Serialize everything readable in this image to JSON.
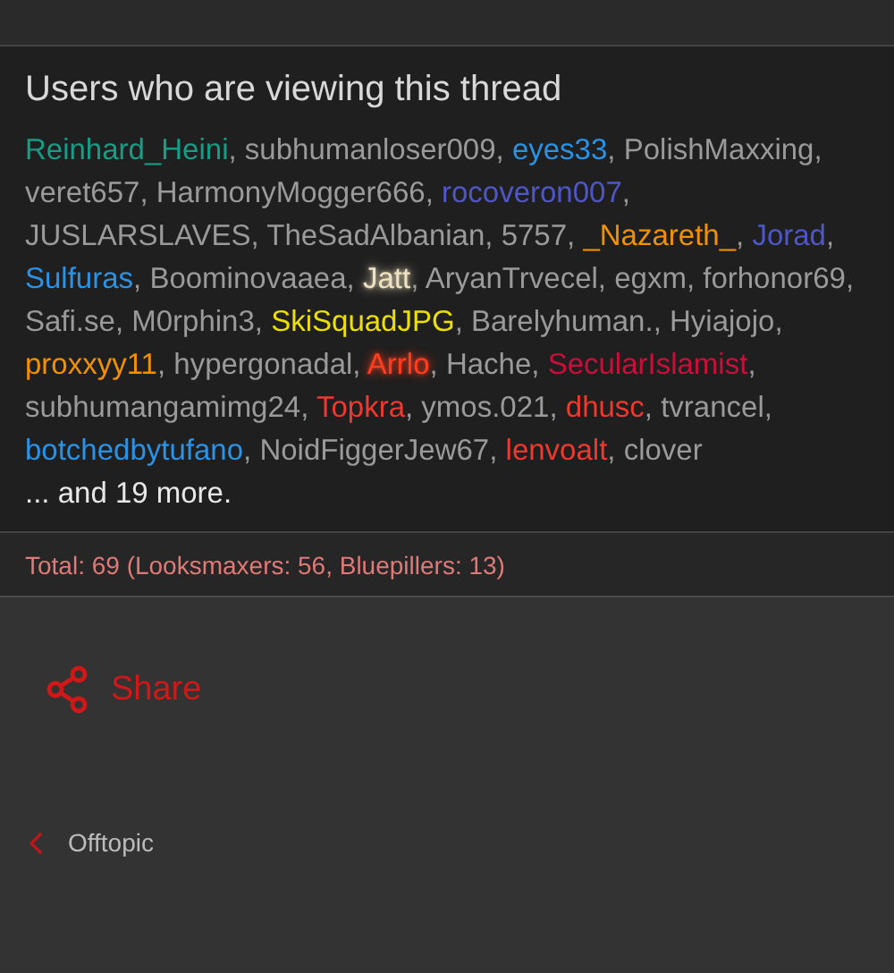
{
  "panel": {
    "title": "Users who are viewing this thread",
    "separator": ", ",
    "users": [
      {
        "name": "Reinhard_Heini",
        "color": "#179c86",
        "glow": false
      },
      {
        "name": "subhumanloser009",
        "color": "#9a9a9a",
        "glow": false
      },
      {
        "name": "eyes33",
        "color": "#2a93e6",
        "glow": false
      },
      {
        "name": "PolishMaxxing",
        "color": "#9a9a9a",
        "glow": false
      },
      {
        "name": "veret657",
        "color": "#9a9a9a",
        "glow": false
      },
      {
        "name": "HarmonyMogger666",
        "color": "#9a9a9a",
        "glow": false
      },
      {
        "name": "rocoveron007",
        "color": "#4f57c8",
        "glow": false
      },
      {
        "name": "JUSLARSLAVES",
        "color": "#9a9a9a",
        "glow": false
      },
      {
        "name": "TheSadAlbanian",
        "color": "#9a9a9a",
        "glow": false
      },
      {
        "name": "5757",
        "color": "#9a9a9a",
        "glow": false
      },
      {
        "name": "_Nazareth_",
        "color": "#f29100",
        "glow": false
      },
      {
        "name": "Jorad",
        "color": "#4f57c8",
        "glow": false
      },
      {
        "name": "Sulfuras",
        "color": "#2a93e6",
        "glow": false
      },
      {
        "name": "Boominovaaea",
        "color": "#9a9a9a",
        "glow": false
      },
      {
        "name": "Jatt",
        "color": "#efe3c2",
        "glow": true
      },
      {
        "name": "AryanTrvecel",
        "color": "#9a9a9a",
        "glow": false
      },
      {
        "name": "egxm",
        "color": "#9a9a9a",
        "glow": false
      },
      {
        "name": "forhonor69",
        "color": "#9a9a9a",
        "glow": false
      },
      {
        "name": "Safi.se",
        "color": "#9a9a9a",
        "glow": false
      },
      {
        "name": "M0rphin3",
        "color": "#9a9a9a",
        "glow": false
      },
      {
        "name": "SkiSquadJPG",
        "color": "#ece000",
        "glow": false
      },
      {
        "name": "Barelyhuman.",
        "color": "#9a9a9a",
        "glow": false
      },
      {
        "name": "Hyiajojo",
        "color": "#9a9a9a",
        "glow": false
      },
      {
        "name": "proxxyy11",
        "color": "#f29100",
        "glow": false
      },
      {
        "name": "hypergonadal",
        "color": "#9a9a9a",
        "glow": false
      },
      {
        "name": "Arrlo",
        "color": "#ff3d1f",
        "glow": true
      },
      {
        "name": "Hache",
        "color": "#9a9a9a",
        "glow": false
      },
      {
        "name": "SecularIslamist",
        "color": "#c8103a",
        "glow": false
      },
      {
        "name": "subhumangamimg24",
        "color": "#9a9a9a",
        "glow": false
      },
      {
        "name": "Topkra",
        "color": "#f0392e",
        "glow": false
      },
      {
        "name": "ymos.021",
        "color": "#9a9a9a",
        "glow": false
      },
      {
        "name": "dhusc",
        "color": "#f0392e",
        "glow": false
      },
      {
        "name": "tvrancel",
        "color": "#9a9a9a",
        "glow": false
      },
      {
        "name": "botchedbytufano",
        "color": "#2a93e6",
        "glow": false
      },
      {
        "name": "NoidFiggerJew67",
        "color": "#9a9a9a",
        "glow": false
      },
      {
        "name": "lenvoalt",
        "color": "#f0392e",
        "glow": false
      },
      {
        "name": "clover",
        "color": "#9a9a9a",
        "glow": false
      }
    ],
    "more": "... and 19 more.",
    "total": "Total: 69 (Looksmaxers: 56, Bluepillers: 13)"
  },
  "share": {
    "label": "Share"
  },
  "breadcrumb": {
    "label": "Offtopic"
  }
}
